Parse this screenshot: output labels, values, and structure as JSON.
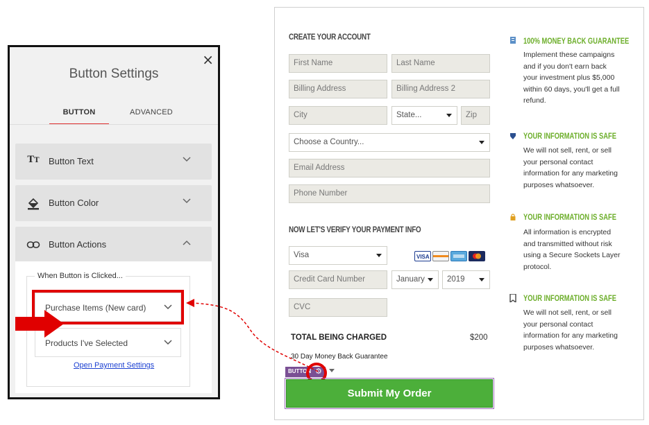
{
  "settings_panel": {
    "title": "Button Settings",
    "close": "×",
    "tabs": [
      {
        "label": "BUTTON",
        "active": true
      },
      {
        "label": "ADVANCED",
        "active": false
      }
    ],
    "sections": [
      {
        "label": "Button Text",
        "icon": "text-size-icon"
      },
      {
        "label": "Button Color",
        "icon": "paint-bucket-icon"
      },
      {
        "label": "Button Actions",
        "icon": "link-icon"
      }
    ],
    "actions": {
      "legend": "When Button is Clicked...",
      "action_select": "Purchase Items (New card)",
      "products_select": "Products I've Selected",
      "payment_link": "Open Payment Settings"
    }
  },
  "order_form": {
    "create_heading": "CREATE YOUR ACCOUNT",
    "fields": {
      "first_name": "First Name",
      "last_name": "Last Name",
      "billing_address": "Billing Address",
      "billing_address_2": "Billing Address 2",
      "city": "City",
      "state": "State...",
      "zip": "Zip",
      "country": "Choose a Country...",
      "email": "Email Address",
      "phone": "Phone Number"
    },
    "payment_heading": "NOW LET'S VERIFY YOUR PAYMENT INFO",
    "card_type": "Visa",
    "card_number": "Credit Card Number",
    "exp_month": "January",
    "exp_year": "2019",
    "cvc": "CVC",
    "total_label": "TOTAL BEING CHARGED",
    "total_value": "$200",
    "guarantee_note": "30 Day Money Back Guarantee",
    "element_tag": "BUTTON",
    "submit_label": "Submit My Order",
    "card_logos": [
      "visa-logo",
      "discover-logo",
      "amex-logo",
      "mastercard-logo"
    ]
  },
  "sidebar": [
    {
      "heading": "100% MONEY BACK GUARANTEE",
      "icon": "document-icon",
      "icon_color": "#5b8fc7",
      "text": "Implement these campaigns and if you don't earn back your investment plus $5,000 within 60 days, you'll get a full refund."
    },
    {
      "heading": "YOUR INFORMATION IS SAFE",
      "icon": "shield-icon",
      "icon_color": "#2b4f8f",
      "text": "We will not sell, rent, or sell your personal contact information for any marketing purposes whatsoever."
    },
    {
      "heading": "YOUR INFORMATION IS SAFE",
      "icon": "lock-icon",
      "icon_color": "#e0a020",
      "text": "All information is encrypted and transmitted without risk using a Secure Sockets Layer protocol."
    },
    {
      "heading": "YOUR INFORMATION IS SAFE",
      "icon": "bookmark-icon",
      "icon_color": "#444444",
      "text": "We will not sell, rent, or sell your personal contact information for any marketing purposes whatsoever."
    }
  ],
  "colors": {
    "accent_red": "#e00000",
    "submit_green": "#4caf3a",
    "heading_green": "#6cae2a",
    "tag_purple": "#7a4f94"
  }
}
